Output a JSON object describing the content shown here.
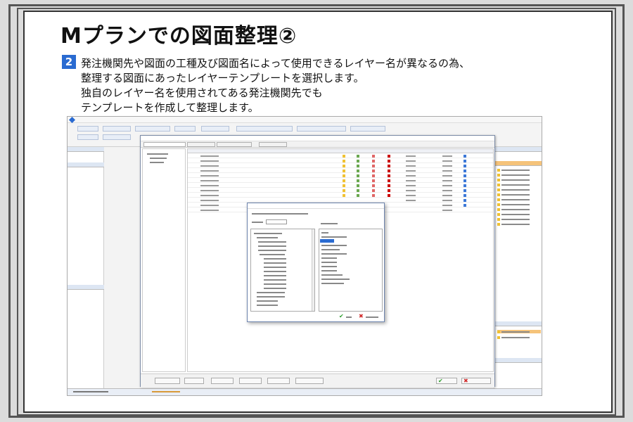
{
  "slide": {
    "title": "Mプランでの図面整理②",
    "bullet_number": "2",
    "lines": [
      "発注機関先や図面の工種及び図面名によって使用できるレイヤー名が異なるの為、",
      "整理する図面にあったレイヤーテンプレートを選択します。",
      "独自のレイヤー名を使用されてある発注機関先でも",
      "テンプレートを作成して整理します。"
    ]
  },
  "screenshot": {
    "icons": [
      "app-logo-icon",
      "check-icon",
      "close-x-icon"
    ],
    "colors": {
      "bullet_bg": "#2a6bd1",
      "selection": "#2a6bd1",
      "ok_green": "#2e9e2e",
      "cancel_red": "#d12a2a",
      "folder_yellow": "#f1c232"
    }
  }
}
